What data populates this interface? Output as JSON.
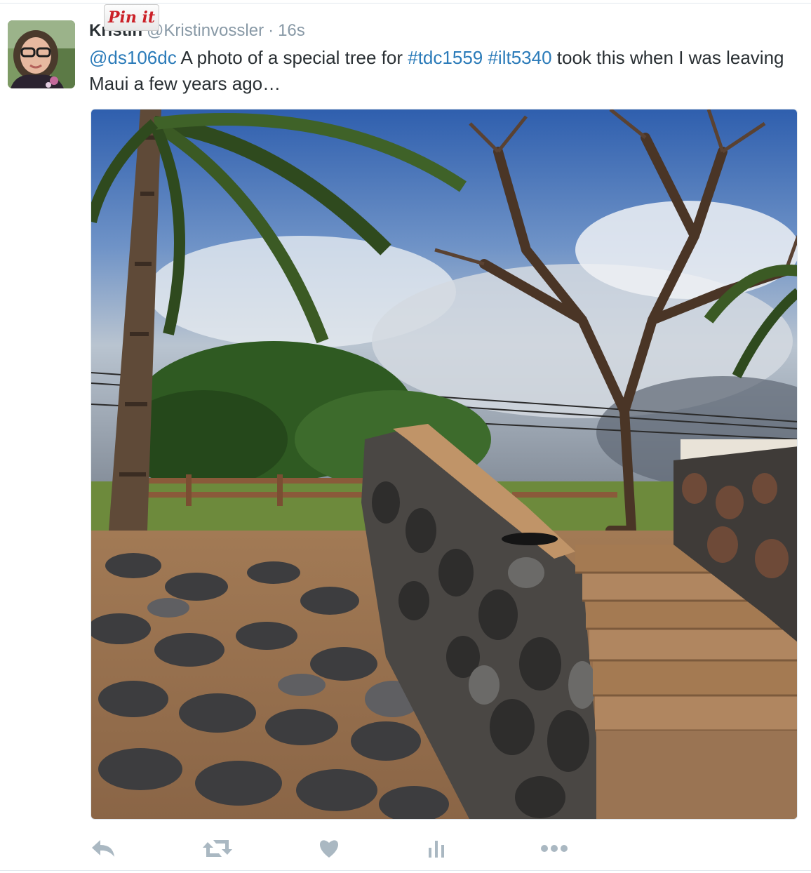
{
  "tweet": {
    "author_name": "Kristin",
    "author_handle": "@Kristinvossler",
    "separator": "·",
    "timestamp": "16s",
    "text_parts": {
      "mention": "@ds106dc",
      "text1": " A photo of a special tree for ",
      "hashtag1": "#tdc1559",
      "space": " ",
      "hashtag2": "#ilt5340",
      "text2": " took this when I was leaving Maui a few years ago…"
    }
  },
  "pin_button": {
    "label": "Pin it"
  },
  "actions": {
    "reply_icon": "reply-icon",
    "retweet_icon": "retweet-icon",
    "like_icon": "heart-icon",
    "analytics_icon": "bar-chart-icon",
    "more_icon": "more-dots-icon"
  },
  "colors": {
    "link": "#2b7bb9",
    "muted": "#8899a6",
    "text": "#292f33",
    "icon": "#aab8c2",
    "pin_red": "#cb2027"
  }
}
